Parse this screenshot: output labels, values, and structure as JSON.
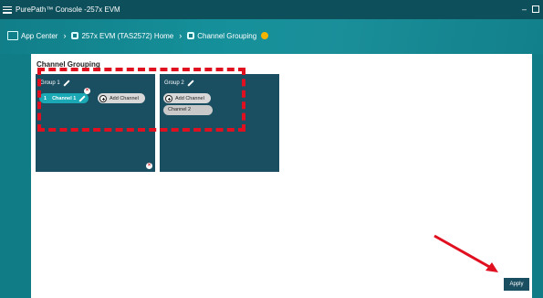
{
  "titlebar": {
    "title": "PurePath™ Console -257x EVM"
  },
  "breadcrumb": {
    "items": [
      "App Center",
      "257x EVM (TAS2572) Home",
      "Channel Grouping"
    ],
    "separator": "›"
  },
  "panel": {
    "title": "Channel Grouping",
    "groups": [
      {
        "name": "Group 1",
        "channel_number": "1",
        "channel_label": "Channel 1",
        "add_label": "Add Channel"
      },
      {
        "name": "Group 2",
        "add_label": "Add Channel",
        "channel_label": "Channel 2"
      }
    ],
    "apply_label": "Apply"
  },
  "colors": {
    "accent": "#0f7c86",
    "group_bg": "#1a4f62",
    "highlight": "#e01020",
    "status_dot": "#f5b400"
  },
  "icons": [
    "menu-icon",
    "app-center-icon",
    "chip-icon",
    "pencil-icon",
    "close-icon",
    "plus-icon"
  ]
}
